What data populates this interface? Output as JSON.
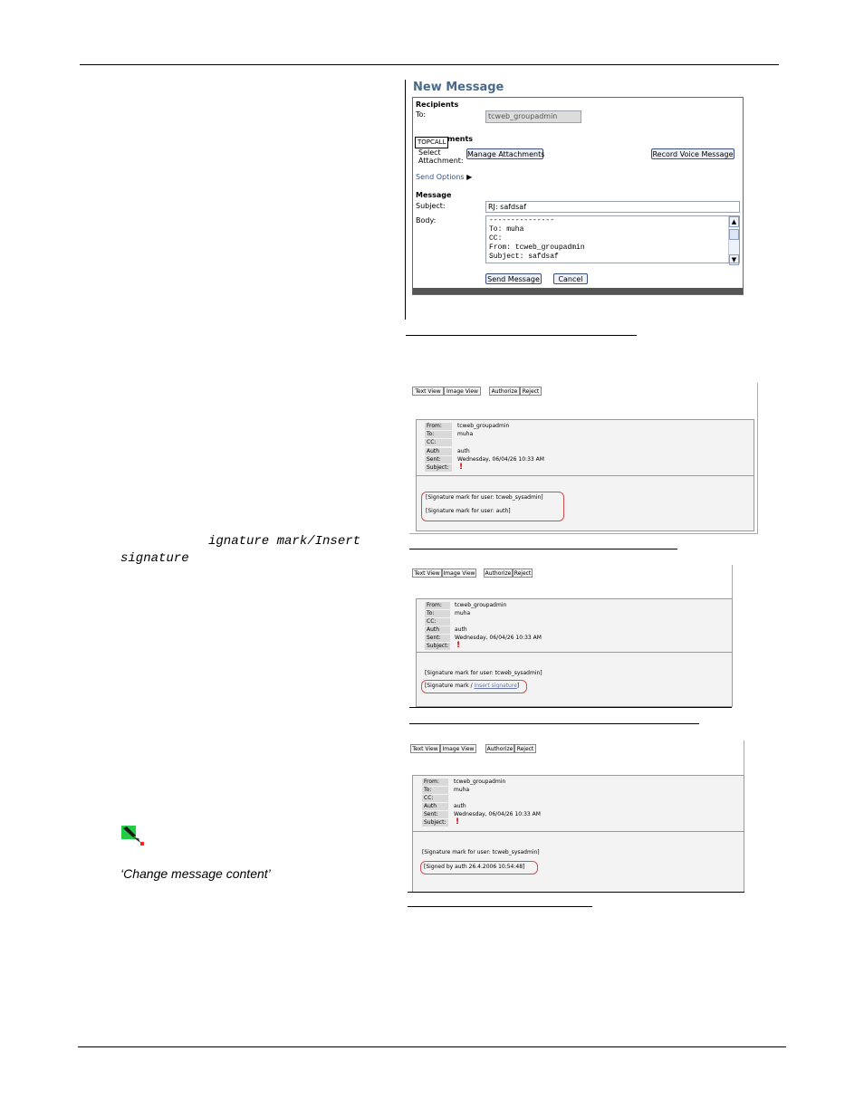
{
  "left": {
    "code_line1": "ignature mark/Insert",
    "code_line2": "signature",
    "italic_text": "‘Change message content’",
    "icon": "pen-icon"
  },
  "new_message": {
    "title": "New Message",
    "recipients_heading": "Recipients",
    "to_label": "To:",
    "to_value": "tcweb_groupadmin",
    "attachments_heading_partial": "ments",
    "tooltip": "TOPCALL",
    "select_label": "Select",
    "attachment_label": "Attachment:",
    "manage_attachments_button": "Manage Attachments",
    "record_voice_button": "Record Voice Message",
    "send_options": "Send Options",
    "message_heading": "Message",
    "subject_label": "Subject:",
    "subject_value": "RJ: safdsaf",
    "body_label": "Body:",
    "body_lines": [
      "---------------",
      "To: muha",
      "CC:",
      "From: tcweb_groupadmin",
      "Subject: safdsaf"
    ],
    "send_button": "Send Message",
    "cancel_button": "Cancel"
  },
  "views": [
    {
      "toolbar": [
        "Text View",
        "Image View",
        "Authorize",
        "Reject"
      ],
      "headers": [
        {
          "label": "From:",
          "value": "tcweb_groupadmin"
        },
        {
          "label": "To:",
          "value": "muha"
        },
        {
          "label": "CC:",
          "value": ""
        },
        {
          "label": "Auth",
          "value": "auth"
        },
        {
          "label": "Sent:",
          "value": "Wednesday, 06/04/26 10:33 AM"
        },
        {
          "label": "Subject:",
          "value": ""
        }
      ],
      "sig_line1": "[Signature mark for user: tcweb_sysadmin]",
      "sig_line2": "[Signature mark for user: auth]"
    },
    {
      "toolbar": [
        "Text View",
        "Image View",
        "Authorize",
        "Reject"
      ],
      "headers": [
        {
          "label": "From:",
          "value": "tcweb_groupadmin"
        },
        {
          "label": "To:",
          "value": "muha"
        },
        {
          "label": "CC:",
          "value": ""
        },
        {
          "label": "Auth",
          "value": "auth"
        },
        {
          "label": "Sent:",
          "value": "Wednesday, 06/04/26 10:33 AM"
        },
        {
          "label": "Subject:",
          "value": ""
        }
      ],
      "sig_line1": "[Signature mark for user: tcweb_sysadmin]",
      "sig_line2_prefix": "[Signature mark / ",
      "sig_line2_link": "Insert signature",
      "sig_line2_suffix": "]"
    },
    {
      "toolbar": [
        "Text View",
        "Image View",
        "Authorize",
        "Reject"
      ],
      "headers": [
        {
          "label": "From:",
          "value": "tcweb_groupadmin"
        },
        {
          "label": "To:",
          "value": "muha"
        },
        {
          "label": "CC:",
          "value": ""
        },
        {
          "label": "Auth",
          "value": "auth"
        },
        {
          "label": "Sent:",
          "value": "Wednesday, 06/04/26 10:33 AM"
        },
        {
          "label": "Subject:",
          "value": ""
        }
      ],
      "sig_line1": "[Signature mark for user: tcweb_sysadmin]",
      "sig_line2": "[Signed by auth 26.4.2006 10:54:48]"
    }
  ]
}
